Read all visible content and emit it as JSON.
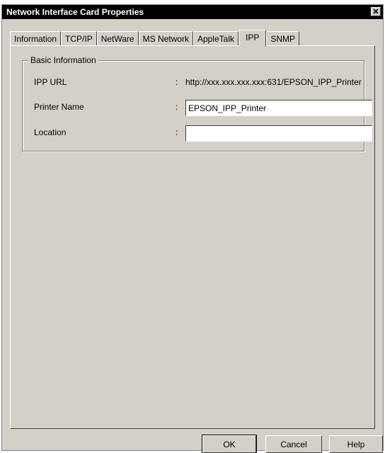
{
  "window": {
    "title": "Network Interface Card Properties"
  },
  "tabs": [
    {
      "label": "Information",
      "active": false
    },
    {
      "label": "TCP/IP",
      "active": false
    },
    {
      "label": "NetWare",
      "active": false
    },
    {
      "label": "MS Network",
      "active": false
    },
    {
      "label": "AppleTalk",
      "active": false
    },
    {
      "label": "IPP",
      "active": true
    },
    {
      "label": "SNMP",
      "active": false
    }
  ],
  "basic_info": {
    "group_label": "Basic Information",
    "ipp_url_label": "IPP URL",
    "ipp_url_value": "http://xxx.xxx.xxx.xxx:631/EPSON_IPP_Printer",
    "printer_name_label": "Printer Name",
    "printer_name_value": "EPSON_IPP_Printer",
    "location_label": "Location",
    "location_value": "",
    "separator": ":"
  },
  "buttons": {
    "ok": "OK",
    "cancel": "Cancel",
    "help": "Help"
  },
  "icons": {
    "close": "close-icon"
  },
  "colors": {
    "dialog_face": "#d4d0c8",
    "titlebar": "#000000",
    "titlebar_text": "#ffffff"
  }
}
